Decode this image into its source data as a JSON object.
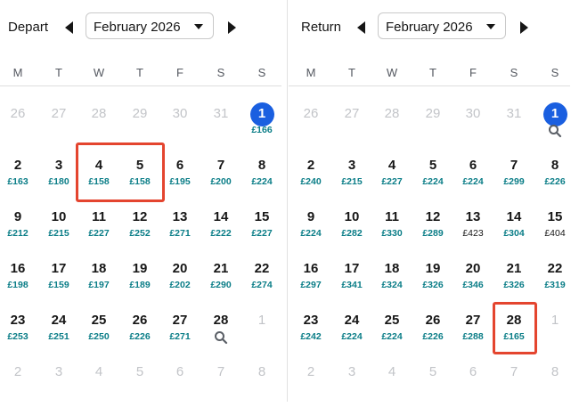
{
  "weekdays": [
    "M",
    "T",
    "W",
    "T",
    "F",
    "S",
    "S"
  ],
  "depart": {
    "label": "Depart",
    "month": "February 2026",
    "rows": [
      [
        {
          "d": "26",
          "dim": true
        },
        {
          "d": "27",
          "dim": true
        },
        {
          "d": "28",
          "dim": true
        },
        {
          "d": "29",
          "dim": true
        },
        {
          "d": "30",
          "dim": true
        },
        {
          "d": "31",
          "dim": true
        },
        {
          "d": "1",
          "p": "£166",
          "today": true
        }
      ],
      [
        {
          "d": "2",
          "p": "£163"
        },
        {
          "d": "3",
          "p": "£180"
        },
        {
          "d": "4",
          "p": "£158"
        },
        {
          "d": "5",
          "p": "£158"
        },
        {
          "d": "6",
          "p": "£195"
        },
        {
          "d": "7",
          "p": "£200"
        },
        {
          "d": "8",
          "p": "£224"
        }
      ],
      [
        {
          "d": "9",
          "p": "£212"
        },
        {
          "d": "10",
          "p": "£215"
        },
        {
          "d": "11",
          "p": "£227"
        },
        {
          "d": "12",
          "p": "£252"
        },
        {
          "d": "13",
          "p": "£271"
        },
        {
          "d": "14",
          "p": "£222"
        },
        {
          "d": "15",
          "p": "£227"
        }
      ],
      [
        {
          "d": "16",
          "p": "£198"
        },
        {
          "d": "17",
          "p": "£159"
        },
        {
          "d": "18",
          "p": "£197"
        },
        {
          "d": "19",
          "p": "£189"
        },
        {
          "d": "20",
          "p": "£202"
        },
        {
          "d": "21",
          "p": "£290"
        },
        {
          "d": "22",
          "p": "£274"
        }
      ],
      [
        {
          "d": "23",
          "p": "£253"
        },
        {
          "d": "24",
          "p": "£251"
        },
        {
          "d": "25",
          "p": "£250"
        },
        {
          "d": "26",
          "p": "£226"
        },
        {
          "d": "27",
          "p": "£271"
        },
        {
          "d": "28",
          "search": true
        },
        {
          "d": "1",
          "dim": true
        }
      ],
      [
        {
          "d": "2",
          "dim": true
        },
        {
          "d": "3",
          "dim": true
        },
        {
          "d": "4",
          "dim": true
        },
        {
          "d": "5",
          "dim": true
        },
        {
          "d": "6",
          "dim": true
        },
        {
          "d": "7",
          "dim": true
        },
        {
          "d": "8",
          "dim": true
        }
      ]
    ]
  },
  "return": {
    "label": "Return",
    "month": "February 2026",
    "rows": [
      [
        {
          "d": "26",
          "dim": true
        },
        {
          "d": "27",
          "dim": true
        },
        {
          "d": "28",
          "dim": true
        },
        {
          "d": "29",
          "dim": true
        },
        {
          "d": "30",
          "dim": true
        },
        {
          "d": "31",
          "dim": true
        },
        {
          "d": "1",
          "today": true,
          "search": true
        }
      ],
      [
        {
          "d": "2",
          "p": "£240"
        },
        {
          "d": "3",
          "p": "£215"
        },
        {
          "d": "4",
          "p": "£227"
        },
        {
          "d": "5",
          "p": "£224"
        },
        {
          "d": "6",
          "p": "£224"
        },
        {
          "d": "7",
          "p": "£299"
        },
        {
          "d": "8",
          "p": "£226"
        }
      ],
      [
        {
          "d": "9",
          "p": "£224"
        },
        {
          "d": "10",
          "p": "£282"
        },
        {
          "d": "11",
          "p": "£330"
        },
        {
          "d": "12",
          "p": "£289"
        },
        {
          "d": "13",
          "p": "£423",
          "neutral": true
        },
        {
          "d": "14",
          "p": "£304"
        },
        {
          "d": "15",
          "p": "£404",
          "neutral": true
        }
      ],
      [
        {
          "d": "16",
          "p": "£297"
        },
        {
          "d": "17",
          "p": "£341"
        },
        {
          "d": "18",
          "p": "£324"
        },
        {
          "d": "19",
          "p": "£326"
        },
        {
          "d": "20",
          "p": "£346"
        },
        {
          "d": "21",
          "p": "£326"
        },
        {
          "d": "22",
          "p": "£319"
        }
      ],
      [
        {
          "d": "23",
          "p": "£242"
        },
        {
          "d": "24",
          "p": "£224"
        },
        {
          "d": "25",
          "p": "£224"
        },
        {
          "d": "26",
          "p": "£226"
        },
        {
          "d": "27",
          "p": "£288"
        },
        {
          "d": "28",
          "p": "£165"
        },
        {
          "d": "1",
          "dim": true
        }
      ],
      [
        {
          "d": "2",
          "dim": true
        },
        {
          "d": "3",
          "dim": true
        },
        {
          "d": "4",
          "dim": true
        },
        {
          "d": "5",
          "dim": true
        },
        {
          "d": "6",
          "dim": true
        },
        {
          "d": "7",
          "dim": true
        },
        {
          "d": "8",
          "dim": true
        }
      ]
    ]
  },
  "colors": {
    "accent": "#1a5fe0",
    "price": "#0a7d87",
    "highlight": "#e4452f",
    "dim": "#c2c4c8"
  }
}
